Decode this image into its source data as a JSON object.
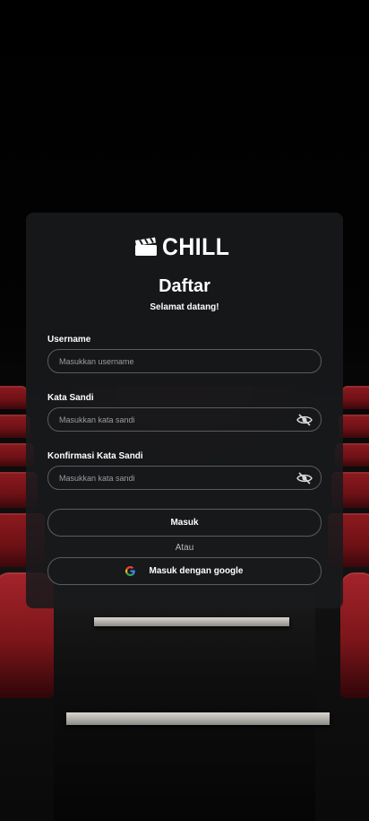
{
  "brand": {
    "name": "CHILL"
  },
  "form": {
    "title": "Daftar",
    "subtitle": "Selamat datang!",
    "username": {
      "label": "Username",
      "placeholder": "Masukkan username",
      "value": ""
    },
    "password": {
      "label": "Kata Sandi",
      "placeholder": "Masukkan kata sandi",
      "value": ""
    },
    "confirm_password": {
      "label": "Konfirmasi Kata Sandi",
      "placeholder": "Masukkan kata sandi",
      "value": ""
    },
    "submit_label": "Masuk",
    "divider_text": "Atau",
    "google_label": "Masuk dengan google"
  },
  "icons": {
    "logo": "clapperboard-icon",
    "password_toggle": "eye-slash-icon",
    "google": "google-icon"
  },
  "colors": {
    "card_bg": "#181a1c",
    "border": "#5a5c60",
    "seat_red": "#8d1a1f",
    "text": "#ffffff"
  }
}
